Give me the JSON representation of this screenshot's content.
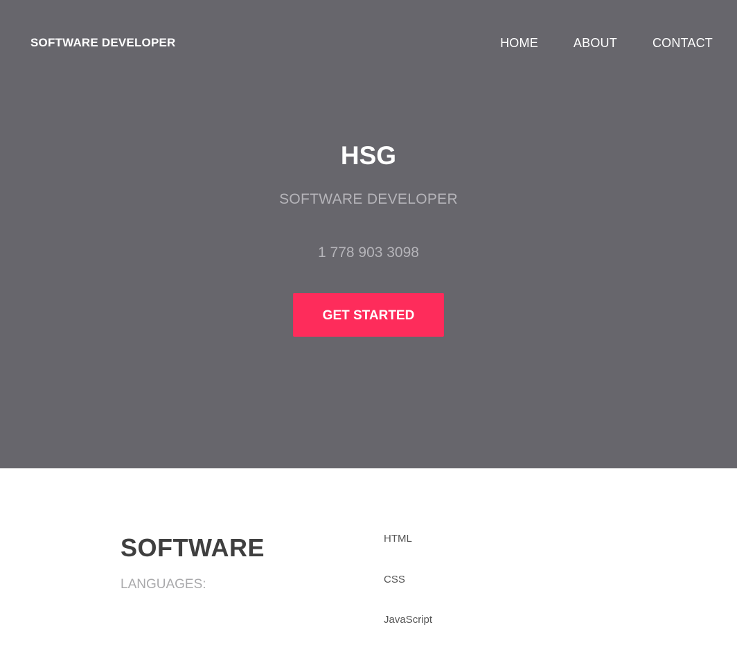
{
  "header": {
    "brand": "SOFTWARE DEVELOPER",
    "nav": [
      {
        "label": "HOME"
      },
      {
        "label": "ABOUT"
      },
      {
        "label": "CONTACT"
      }
    ]
  },
  "hero": {
    "title": "HSG",
    "subtitle": "SOFTWARE DEVELOPER",
    "phone": "1 778 903 3098",
    "cta_label": "GET STARTED"
  },
  "skills": {
    "heading": "SOFTWARE",
    "subheading": "LANGUAGES:",
    "items": [
      "HTML",
      "CSS",
      "JavaScript"
    ]
  },
  "colors": {
    "hero_background": "#67666c",
    "accent": "#fe2c5b",
    "muted_text": "#b5b4b9",
    "heading_text": "#3f3f3f"
  }
}
